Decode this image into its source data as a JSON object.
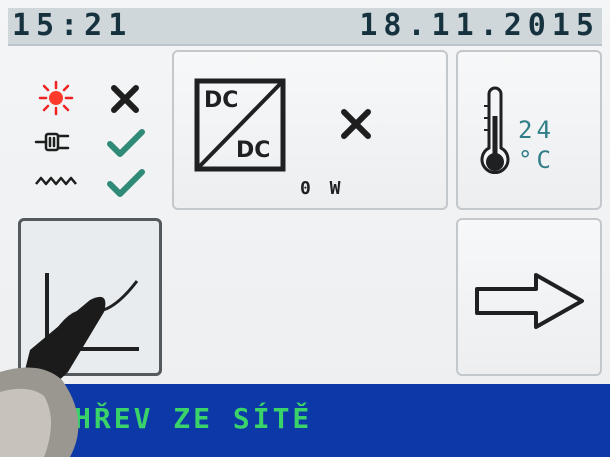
{
  "header": {
    "time": "15:21",
    "date": "18.11.2015"
  },
  "status": {
    "rows": [
      {
        "icon": "sun-icon",
        "state": "off"
      },
      {
        "icon": "plug-icon",
        "state": "on"
      },
      {
        "icon": "heater-wave-icon",
        "state": "on"
      }
    ]
  },
  "converter": {
    "top_label": "DC",
    "bottom_label": "DC",
    "state": "off",
    "power": "0 W"
  },
  "temperature": {
    "value": "24",
    "unit": "°C"
  },
  "footer": {
    "message": "HŘEV ZE SÍTĚ"
  },
  "colors": {
    "check": "#2f8a78",
    "cross": "#1e1e1e",
    "sun": "#ee2222",
    "footer_bg": "#0d39a8",
    "footer_text": "#39d36a"
  }
}
